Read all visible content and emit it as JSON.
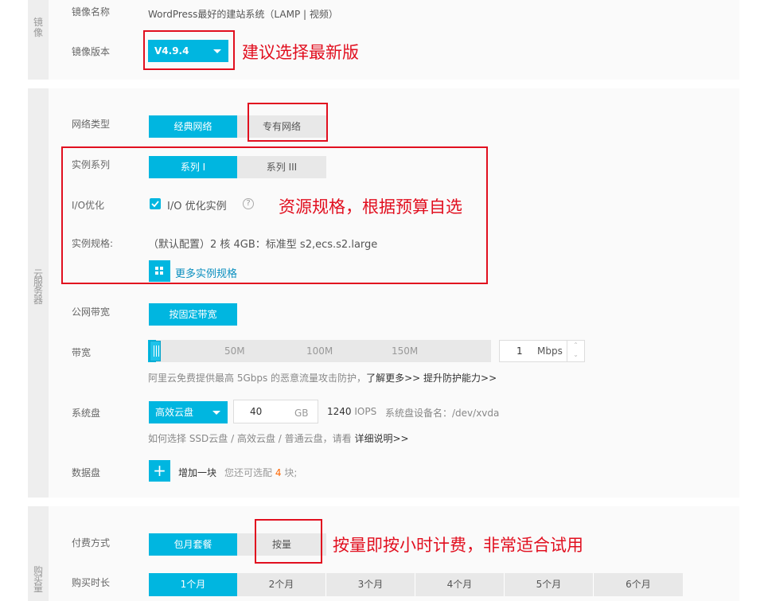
{
  "image_section": {
    "side_label": "镜像",
    "name_label": "镜像名称",
    "name_value": "WordPress最好的建站系统（LAMP | 视频）",
    "version_label": "镜像版本",
    "version_value": "V4.9.4",
    "annotation": "建议选择最新版"
  },
  "server_section": {
    "side_label": "云服务器",
    "network": {
      "label": "网络类型",
      "options": [
        "经典网络",
        "专有网络"
      ]
    },
    "series": {
      "label": "实例系列",
      "options": [
        "系列 I",
        "系列 III"
      ]
    },
    "io": {
      "label": "I/O优化",
      "checkbox_label": "I/O 优化实例",
      "help": "?"
    },
    "spec": {
      "label": "实例规格:",
      "value": "（默认配置）2 核 4GB：标准型 s2,ecs.s2.large",
      "more_link": "更多实例规格"
    },
    "annotation": "资源规格，根据预算自选",
    "bandwidth_type": {
      "label": "公网带宽",
      "button": "按固定带宽"
    },
    "bandwidth": {
      "label": "带宽",
      "ticks": [
        "50M",
        "100M",
        "150M"
      ],
      "value": "1",
      "unit": "Mbps",
      "level_mbps": 1,
      "note_prefix": "阿里云免费提供最高 5Gbps 的恶意流量攻击防护，",
      "link1": "了解更多>>",
      "link2": "提升防护能力>>"
    },
    "system_disk": {
      "label": "系统盘",
      "type": "高效云盘",
      "size": "40",
      "unit": "GB",
      "iops_value": "1240",
      "iops_unit": "IOPS",
      "device_label": "系统盘设备名：/dev/xvda",
      "note_prefix": "如何选择 SSD云盘 / 高效云盘 / 普通云盘，请看 ",
      "note_link": "详细说明>>"
    },
    "data_disk": {
      "label": "数据盘",
      "add": "增加一块",
      "hint_prefix": "您还可选配",
      "hint_count": "4",
      "hint_suffix": "块;"
    }
  },
  "purchase_section": {
    "side_label": "购买量",
    "payment": {
      "label": "付费方式",
      "options": [
        "包月套餐",
        "按量"
      ]
    },
    "annotation": "按量即按小时计费，非常适合试用",
    "duration": {
      "label": "购买时长",
      "options": [
        "1个月",
        "2个月",
        "3个月",
        "4个月",
        "5个月",
        "6个月"
      ]
    }
  },
  "colors": {
    "accent": "#00b6e0",
    "annotation_red": "#e10f1f",
    "count_orange": "#ff6600"
  }
}
